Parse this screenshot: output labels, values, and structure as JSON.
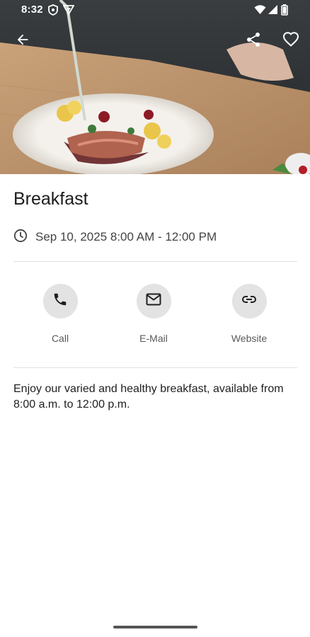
{
  "status_bar": {
    "time": "8:32",
    "icons": [
      "shield-icon",
      "vpn-icon",
      "wifi-icon",
      "signal-icon",
      "battery-icon"
    ]
  },
  "header": {
    "image": "food-plate-photo",
    "back_icon": "arrow-back-icon",
    "share_icon": "share-icon",
    "favorite_icon": "heart-outline-icon"
  },
  "event": {
    "title": "Breakfast",
    "date_icon": "clock-icon",
    "date_range": "Sep 10, 2025 8:00 AM - 12:00 PM",
    "description": "Enjoy our varied and healthy breakfast, available from 8:00 a.m. to 12:00 p.m."
  },
  "actions": [
    {
      "label": "Call",
      "icon": "phone-icon"
    },
    {
      "label": "E-Mail",
      "icon": "mail-icon"
    },
    {
      "label": "Website",
      "icon": "link-icon"
    }
  ],
  "colors": {
    "action_circle": "#e3e3e3",
    "icon": "#1f1f1f",
    "label": "#5a5a5a",
    "divider": "#e2e2e2"
  }
}
